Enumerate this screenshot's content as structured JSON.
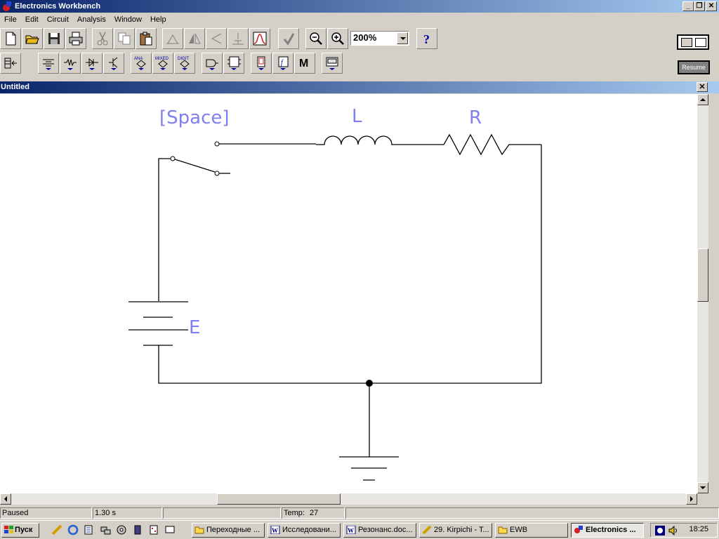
{
  "app": {
    "title": "Electronics Workbench"
  },
  "menu": [
    "File",
    "Edit",
    "Circuit",
    "Analysis",
    "Window",
    "Help"
  ],
  "toolbar": {
    "zoom": "200%",
    "help_glyph": "?",
    "resume_label": "Resume"
  },
  "toolbar2": {
    "analog_label": "ANA",
    "mixed_label": "MIXED",
    "digital_label": "DIGIT",
    "misc_label": "M"
  },
  "document": {
    "title": "Untitled"
  },
  "circuit": {
    "switch_label": "[Space]",
    "inductor_label": "L",
    "resistor_label": "R",
    "battery_label": "E",
    "colors": {
      "wire": "#000000",
      "label": "#7f7fef"
    }
  },
  "status": {
    "state": "Paused",
    "time": "1.30 s",
    "temp_label": "Temp:",
    "temp_value": "27"
  },
  "taskbar": {
    "start_label": "Пуск",
    "tasks": [
      "Переходные ...",
      "Исследовани...",
      "Резонанс.doc...",
      "29. Kirpichi - T...",
      "EWB",
      "Electronics ..."
    ],
    "clock": "18:25"
  }
}
